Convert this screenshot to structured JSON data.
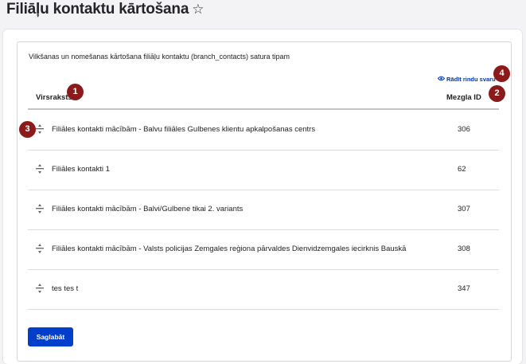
{
  "page": {
    "title": "Filiāļu kontaktu kārtošana",
    "favorite_icon": "star-outline-icon"
  },
  "form": {
    "caption": "Vilkšanas un nomešanas kārtošana filiāļu kontaktu (branch_contacts) satura tipam",
    "show_weights_label": "Rādīt rindu svaru",
    "columns": {
      "title": "Virsraksts",
      "nid": "Mezgla ID"
    },
    "rows": [
      {
        "title": "Filiāles kontakti mācībām - Balvu filiāles Gulbenes klientu apkalpošanas centrs",
        "nid": "306"
      },
      {
        "title": "Filiāles kontakti 1",
        "nid": "62"
      },
      {
        "title": "Filiāles kontakti mācībām - Balvi/Gulbene tikai 2. variants",
        "nid": "307"
      },
      {
        "title": "Filiāles kontakti mācībām - Valsts policijas Zemgales reģiona pārvaldes Dienvidzemgales iecirknis Bauskā",
        "nid": "308"
      },
      {
        "title": "tes tes t",
        "nid": "347"
      }
    ],
    "save_label": "Saglabāt"
  },
  "markers": [
    "1",
    "2",
    "3",
    "4"
  ],
  "colors": {
    "primary": "#003ecc",
    "link": "#0036b1",
    "marker": "#8b1a1a"
  }
}
